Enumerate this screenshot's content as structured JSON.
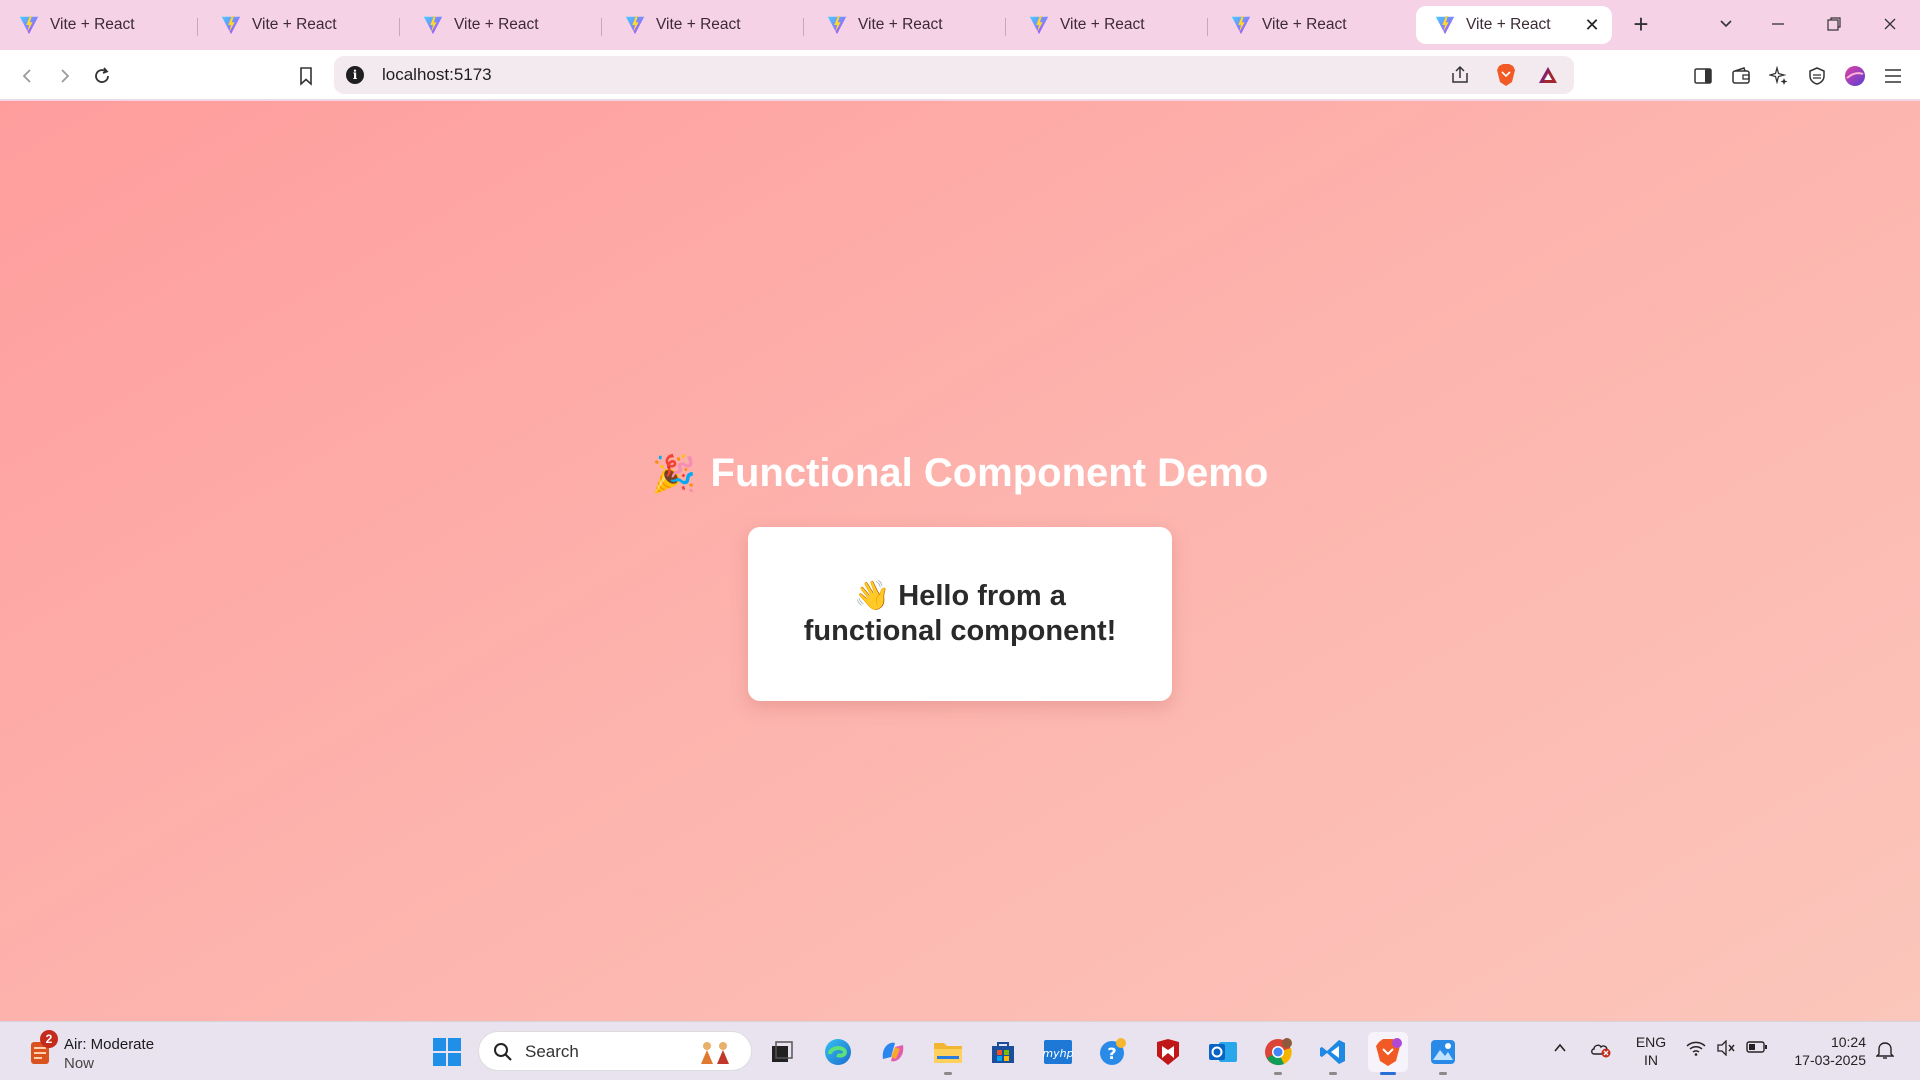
{
  "browser": {
    "tabs": [
      {
        "title": "Vite + React",
        "active": false
      },
      {
        "title": "Vite + React",
        "active": false
      },
      {
        "title": "Vite + React",
        "active": false
      },
      {
        "title": "Vite + React",
        "active": false
      },
      {
        "title": "Vite + React",
        "active": false
      },
      {
        "title": "Vite + React",
        "active": false
      },
      {
        "title": "Vite + React",
        "active": false
      },
      {
        "title": "Vite + React",
        "active": true
      }
    ],
    "address": "localhost:5173"
  },
  "page": {
    "heading_emoji": "🎉",
    "heading": "Functional Component Demo",
    "card_emoji": "👋",
    "card_text": "Hello from a functional component!"
  },
  "taskbar": {
    "weather_title": "Air: Moderate",
    "weather_sub": "Now",
    "weather_badge": "2",
    "search_placeholder": "Search",
    "lang_line1": "ENG",
    "lang_line2": "IN",
    "time": "10:24",
    "date": "17-03-2025"
  },
  "colors": {
    "tabstrip": "#f5d2e6",
    "page_gradient_start": "#ff9d9d",
    "page_gradient_end": "#fbc6bb",
    "heading_text": "#ffffff",
    "card_bg": "#ffffff"
  }
}
